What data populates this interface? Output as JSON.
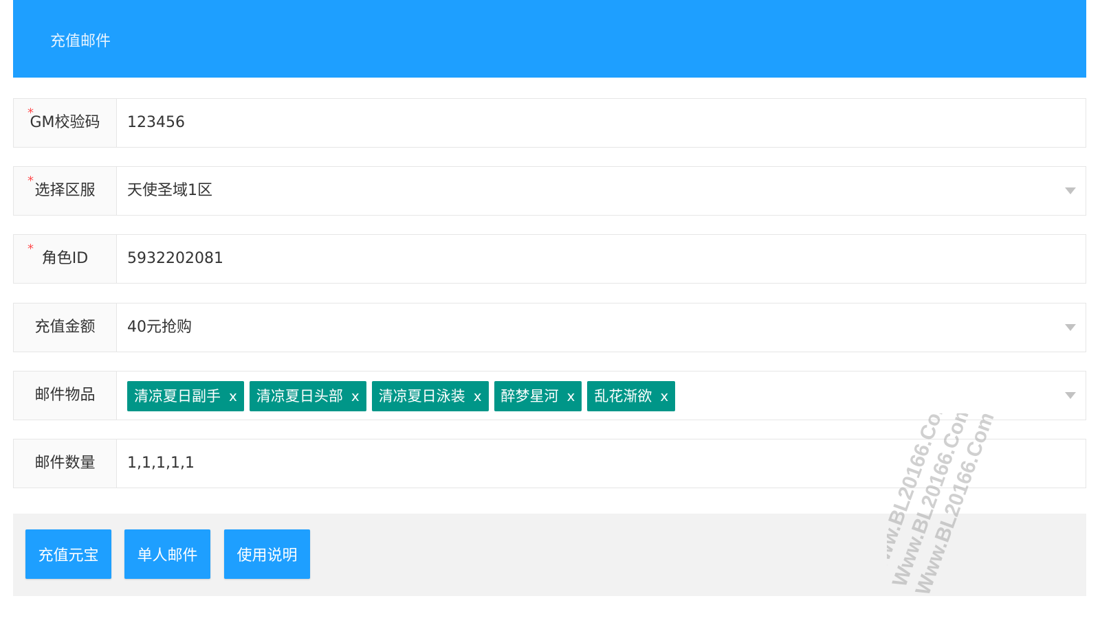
{
  "header": {
    "title": "充值邮件"
  },
  "form": {
    "gm_code": {
      "label": "GM校验码",
      "required": true,
      "value": "123456"
    },
    "server": {
      "label": "选择区服",
      "required": true,
      "value": "天使圣域1区"
    },
    "role_id": {
      "label": "角色ID",
      "required": true,
      "value": "5932202081"
    },
    "amount": {
      "label": "充值金额",
      "required": false,
      "value": "40元抢购"
    },
    "items": {
      "label": "邮件物品",
      "required": false,
      "tags": [
        "清凉夏日副手",
        "清凉夏日头部",
        "清凉夏日泳装",
        "醉梦星河",
        "乱花渐欲"
      ]
    },
    "quantity": {
      "label": "邮件数量",
      "required": false,
      "value": "1,1,1,1,1"
    }
  },
  "toolbar": {
    "recharge_label": "充值元宝",
    "single_mail_label": "单人邮件",
    "help_label": "使用说明"
  },
  "watermark": {
    "text": "Www.BL20166.Com"
  },
  "colors": {
    "primary": "#1e9fff",
    "tag": "#009688",
    "required": "#ff4d4f"
  }
}
